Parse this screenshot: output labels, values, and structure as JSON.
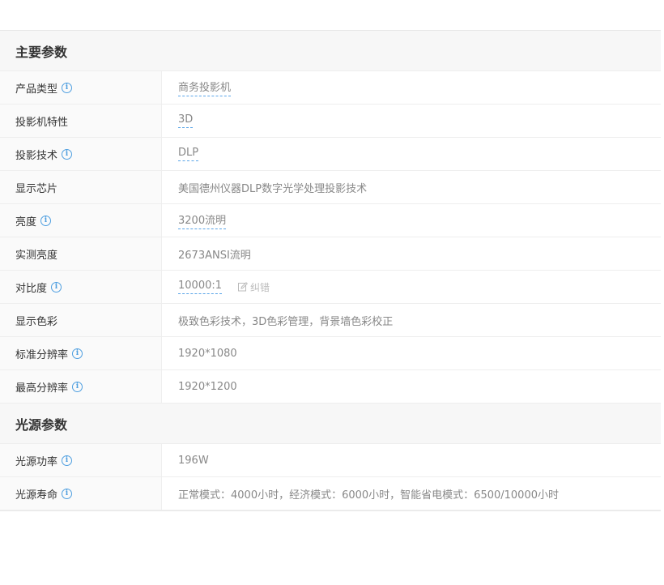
{
  "sections": [
    {
      "title": "主要参数",
      "rows": [
        {
          "label": "产品类型",
          "value": "商务投影机",
          "info": true,
          "link": true
        },
        {
          "label": "投影机特性",
          "value": "3D",
          "info": false,
          "link": true
        },
        {
          "label": "投影技术",
          "value": "DLP",
          "info": true,
          "link": true
        },
        {
          "label": "显示芯片",
          "value": "美国德州仪器DLP数字光学处理投影技术",
          "info": false,
          "link": false
        },
        {
          "label": "亮度",
          "value": "3200流明",
          "info": true,
          "link": true
        },
        {
          "label": "实测亮度",
          "value": "2673ANSI流明",
          "info": false,
          "link": false
        },
        {
          "label": "对比度",
          "value": "10000:1",
          "info": true,
          "link": true,
          "correction": "纠错"
        },
        {
          "label": "显示色彩",
          "value": "极致色彩技术，3D色彩管理，背景墙色彩校正",
          "info": false,
          "link": false
        },
        {
          "label": "标准分辨率",
          "value": "1920*1080",
          "info": true,
          "link": false
        },
        {
          "label": "最高分辨率",
          "value": "1920*1200",
          "info": true,
          "link": false
        }
      ]
    },
    {
      "title": "光源参数",
      "rows": [
        {
          "label": "光源功率",
          "value": "196W",
          "info": true,
          "link": false
        },
        {
          "label": "光源寿命",
          "value": "正常模式：4000小时，经济模式：6000小时，智能省电模式：6500/10000小时",
          "info": true,
          "link": false
        }
      ]
    }
  ],
  "icons": {
    "info": "info-icon",
    "correction": "edit-icon"
  },
  "colors": {
    "accent": "#4f9fe0",
    "section_bg": "#f7f7f7",
    "label_bg": "#fafafa",
    "border": "#eeeeee"
  }
}
